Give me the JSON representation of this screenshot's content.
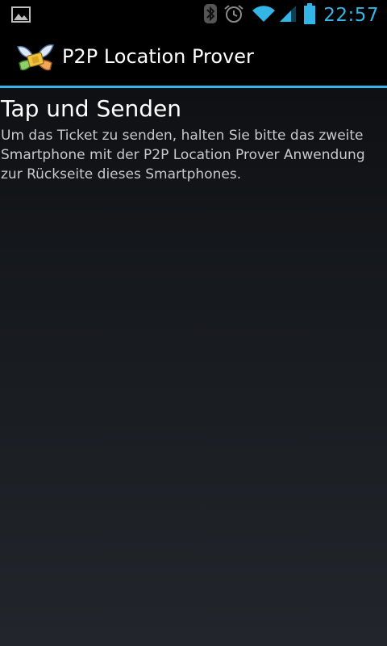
{
  "status_bar": {
    "notification_icon": "image-icon",
    "icons": [
      "bluetooth-icon",
      "alarm-icon",
      "wifi-icon",
      "signal-icon",
      "battery-icon"
    ],
    "time": "22:57",
    "accent_color": "#33b5e5"
  },
  "action_bar": {
    "app_icon": "butterfly-ticket-icon",
    "title": "P2P Location Prover",
    "divider_color": "#33b5e5"
  },
  "content": {
    "heading": "Tap und Senden",
    "body": "Um das Ticket zu senden, halten Sie bitte das zweite Smartphone mit der P2P Location Prover Anwendung zur Rückseite dieses Smartphones."
  }
}
